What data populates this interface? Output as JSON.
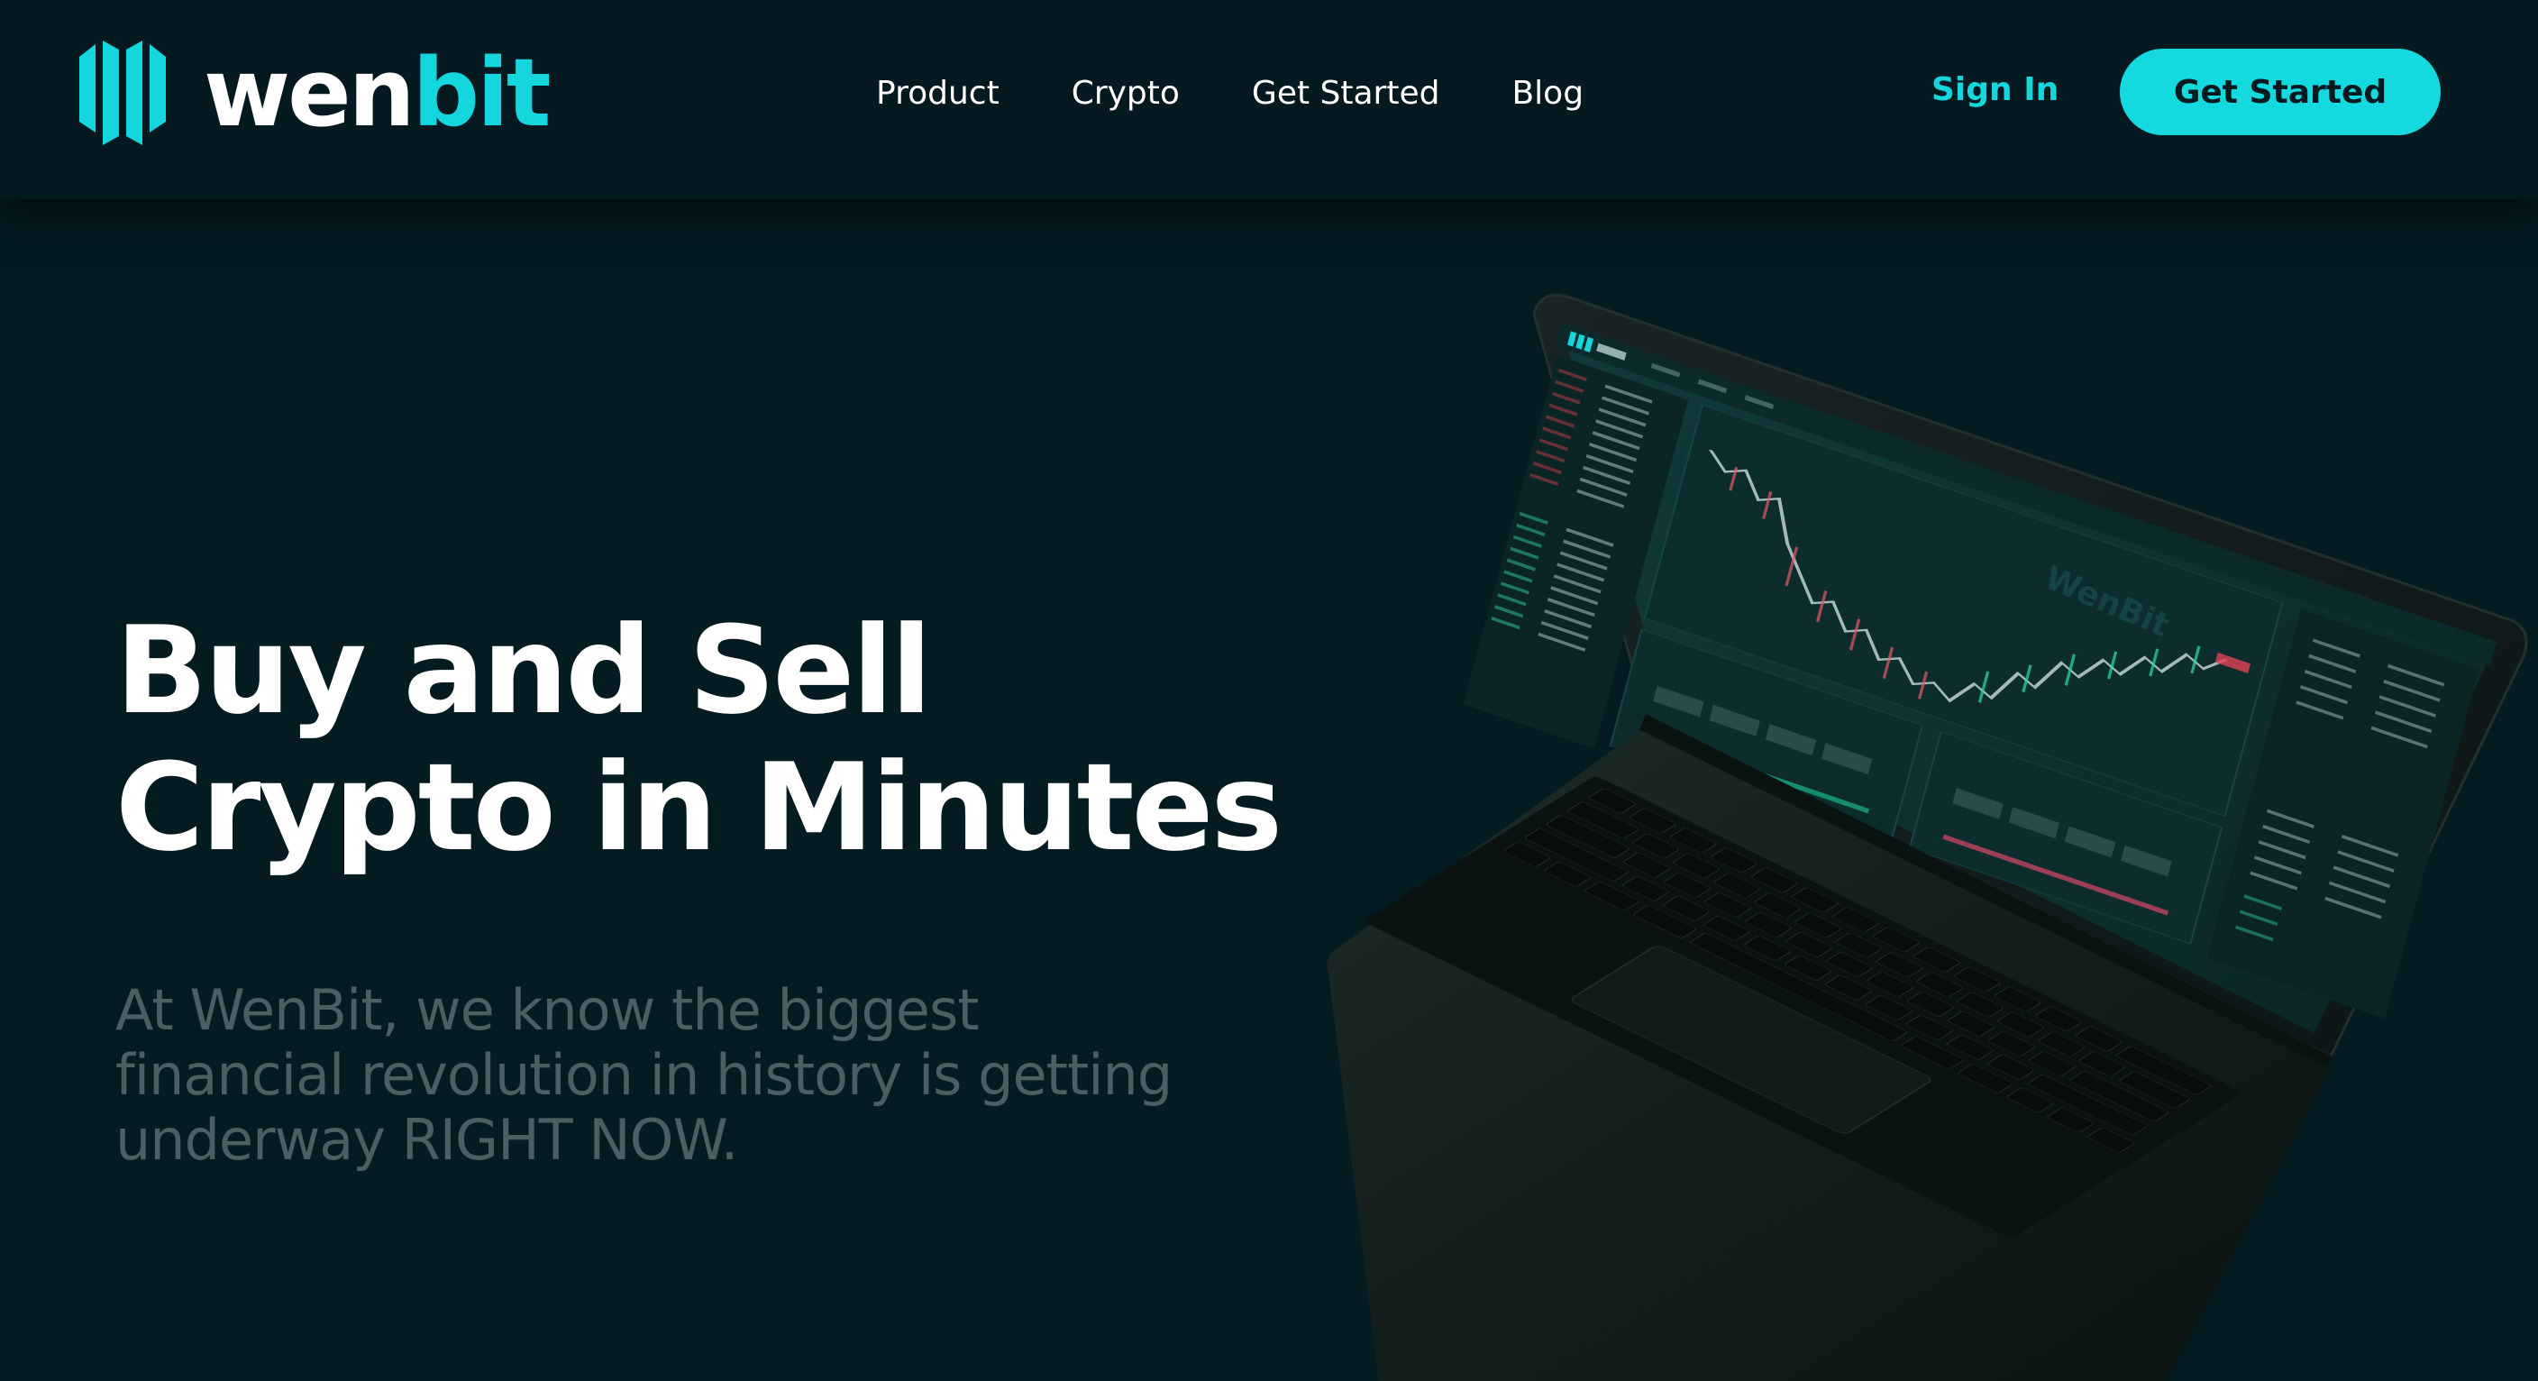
{
  "brand": {
    "name_part1": "wen",
    "name_part2": "bit",
    "accent_color": "#14d6dc",
    "logo_icon": "wenbit-logo-icon"
  },
  "nav": {
    "items": [
      {
        "label": "Product"
      },
      {
        "label": "Crypto"
      },
      {
        "label": "Get Started"
      },
      {
        "label": "Blog"
      }
    ]
  },
  "header_actions": {
    "sign_in_label": "Sign In",
    "cta_label": "Get Started"
  },
  "hero": {
    "title_line1": "Buy and Sell",
    "title_line2": "Crypto in Minutes",
    "subtitle_line1": "At WenBit, we know the biggest",
    "subtitle_line2": "financial revolution in history is getting",
    "subtitle_line3": "underway RIGHT NOW."
  },
  "laptop_screen": {
    "watermark": "WenBit",
    "app_logo": "wenbit"
  }
}
